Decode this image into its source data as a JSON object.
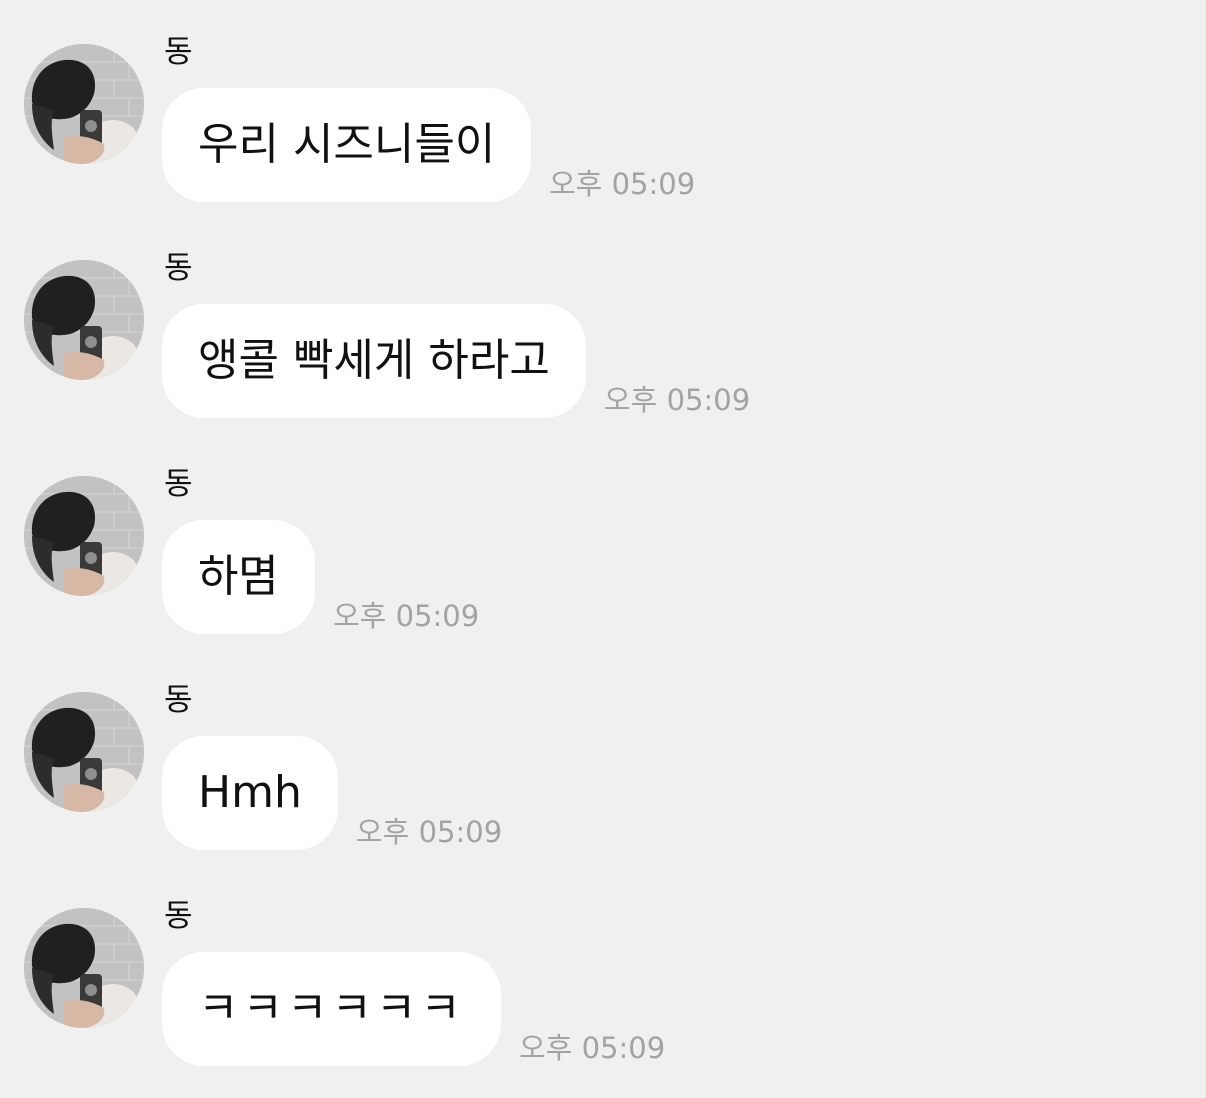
{
  "theme": {
    "background": "#f0f0f0",
    "bubble": "#ffffff",
    "text": "#111111",
    "time": "#a3a3a3"
  },
  "messages": [
    {
      "sender": "동",
      "text": "우리 시즈니들이",
      "time": "오후 05:09",
      "avatar_icon": "profile-photo"
    },
    {
      "sender": "동",
      "text": "앵콜 빡세게 하라고",
      "time": "오후 05:09",
      "avatar_icon": "profile-photo"
    },
    {
      "sender": "동",
      "text": "하몀",
      "time": "오후 05:09",
      "avatar_icon": "profile-photo"
    },
    {
      "sender": "동",
      "text": "Hmh",
      "time": "오후 05:09",
      "avatar_icon": "profile-photo"
    },
    {
      "sender": "동",
      "text": "ㅋㅋㅋㅋㅋㅋ",
      "time": "오후 05:09",
      "avatar_icon": "profile-photo"
    }
  ]
}
